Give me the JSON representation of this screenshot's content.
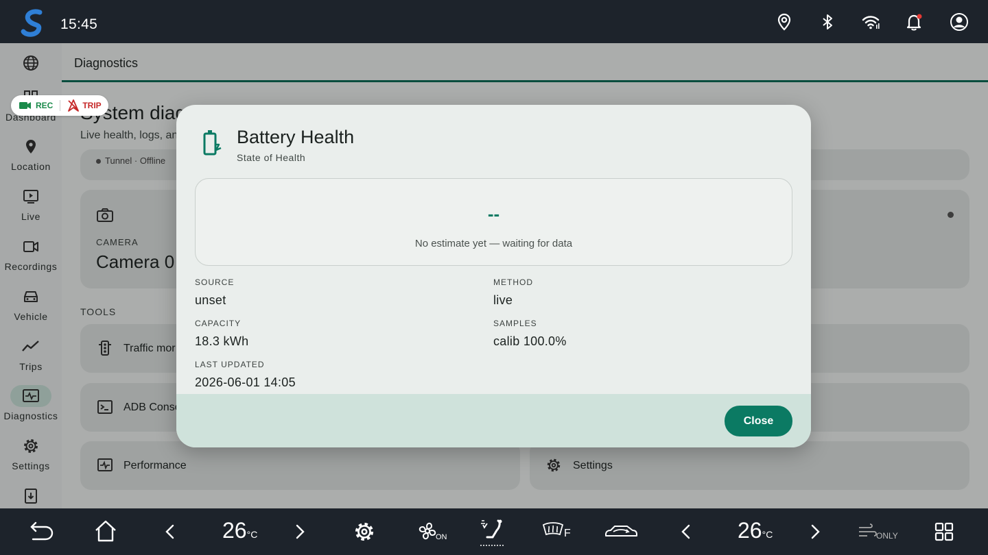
{
  "status_bar": {
    "time": "15:45"
  },
  "sidebar": {
    "items": [
      {
        "label": ""
      },
      {
        "label": "Dashboard"
      },
      {
        "label": "Location"
      },
      {
        "label": "Live"
      },
      {
        "label": "Recordings"
      },
      {
        "label": "Vehicle"
      },
      {
        "label": "Trips"
      },
      {
        "label": "Diagnostics"
      },
      {
        "label": "Settings"
      }
    ]
  },
  "main": {
    "tab": "Diagnostics",
    "title": "System diag",
    "subtitle": "Live health, logs, and",
    "status_strip": "Tunnel · Offline",
    "camera_card": {
      "label": "CAMERA",
      "value": "Camera 0"
    },
    "tools_label": "TOOLS",
    "tools": [
      "Traffic mor",
      "ADB Conso",
      "Performance",
      "Settings"
    ]
  },
  "pill": {
    "rec": "REC",
    "trip": "TRIP"
  },
  "dialog": {
    "title": "Battery Health",
    "subtitle": "State of Health",
    "estimate_value": "--",
    "estimate_message": "No estimate yet — waiting for data",
    "fields": {
      "source": {
        "label": "SOURCE",
        "value": "unset"
      },
      "method": {
        "label": "METHOD",
        "value": "live"
      },
      "capacity": {
        "label": "CAPACITY",
        "value": "18.3 kWh"
      },
      "samples": {
        "label": "SAMPLES",
        "value": "calib 100.0%"
      },
      "last_updated": {
        "label": "LAST UPDATED",
        "value": "2026-06-01 14:05"
      }
    },
    "close_label": "Close"
  },
  "bottom_bar": {
    "left_temp": "26",
    "right_temp": "26",
    "temp_unit": "°C",
    "fan_label": "ON",
    "defrost_label": "F",
    "ac_label": "ONLY"
  },
  "colors": {
    "accent": "#0b7a63",
    "bar": "#1d232b",
    "active_nav": "#c7ded6"
  }
}
